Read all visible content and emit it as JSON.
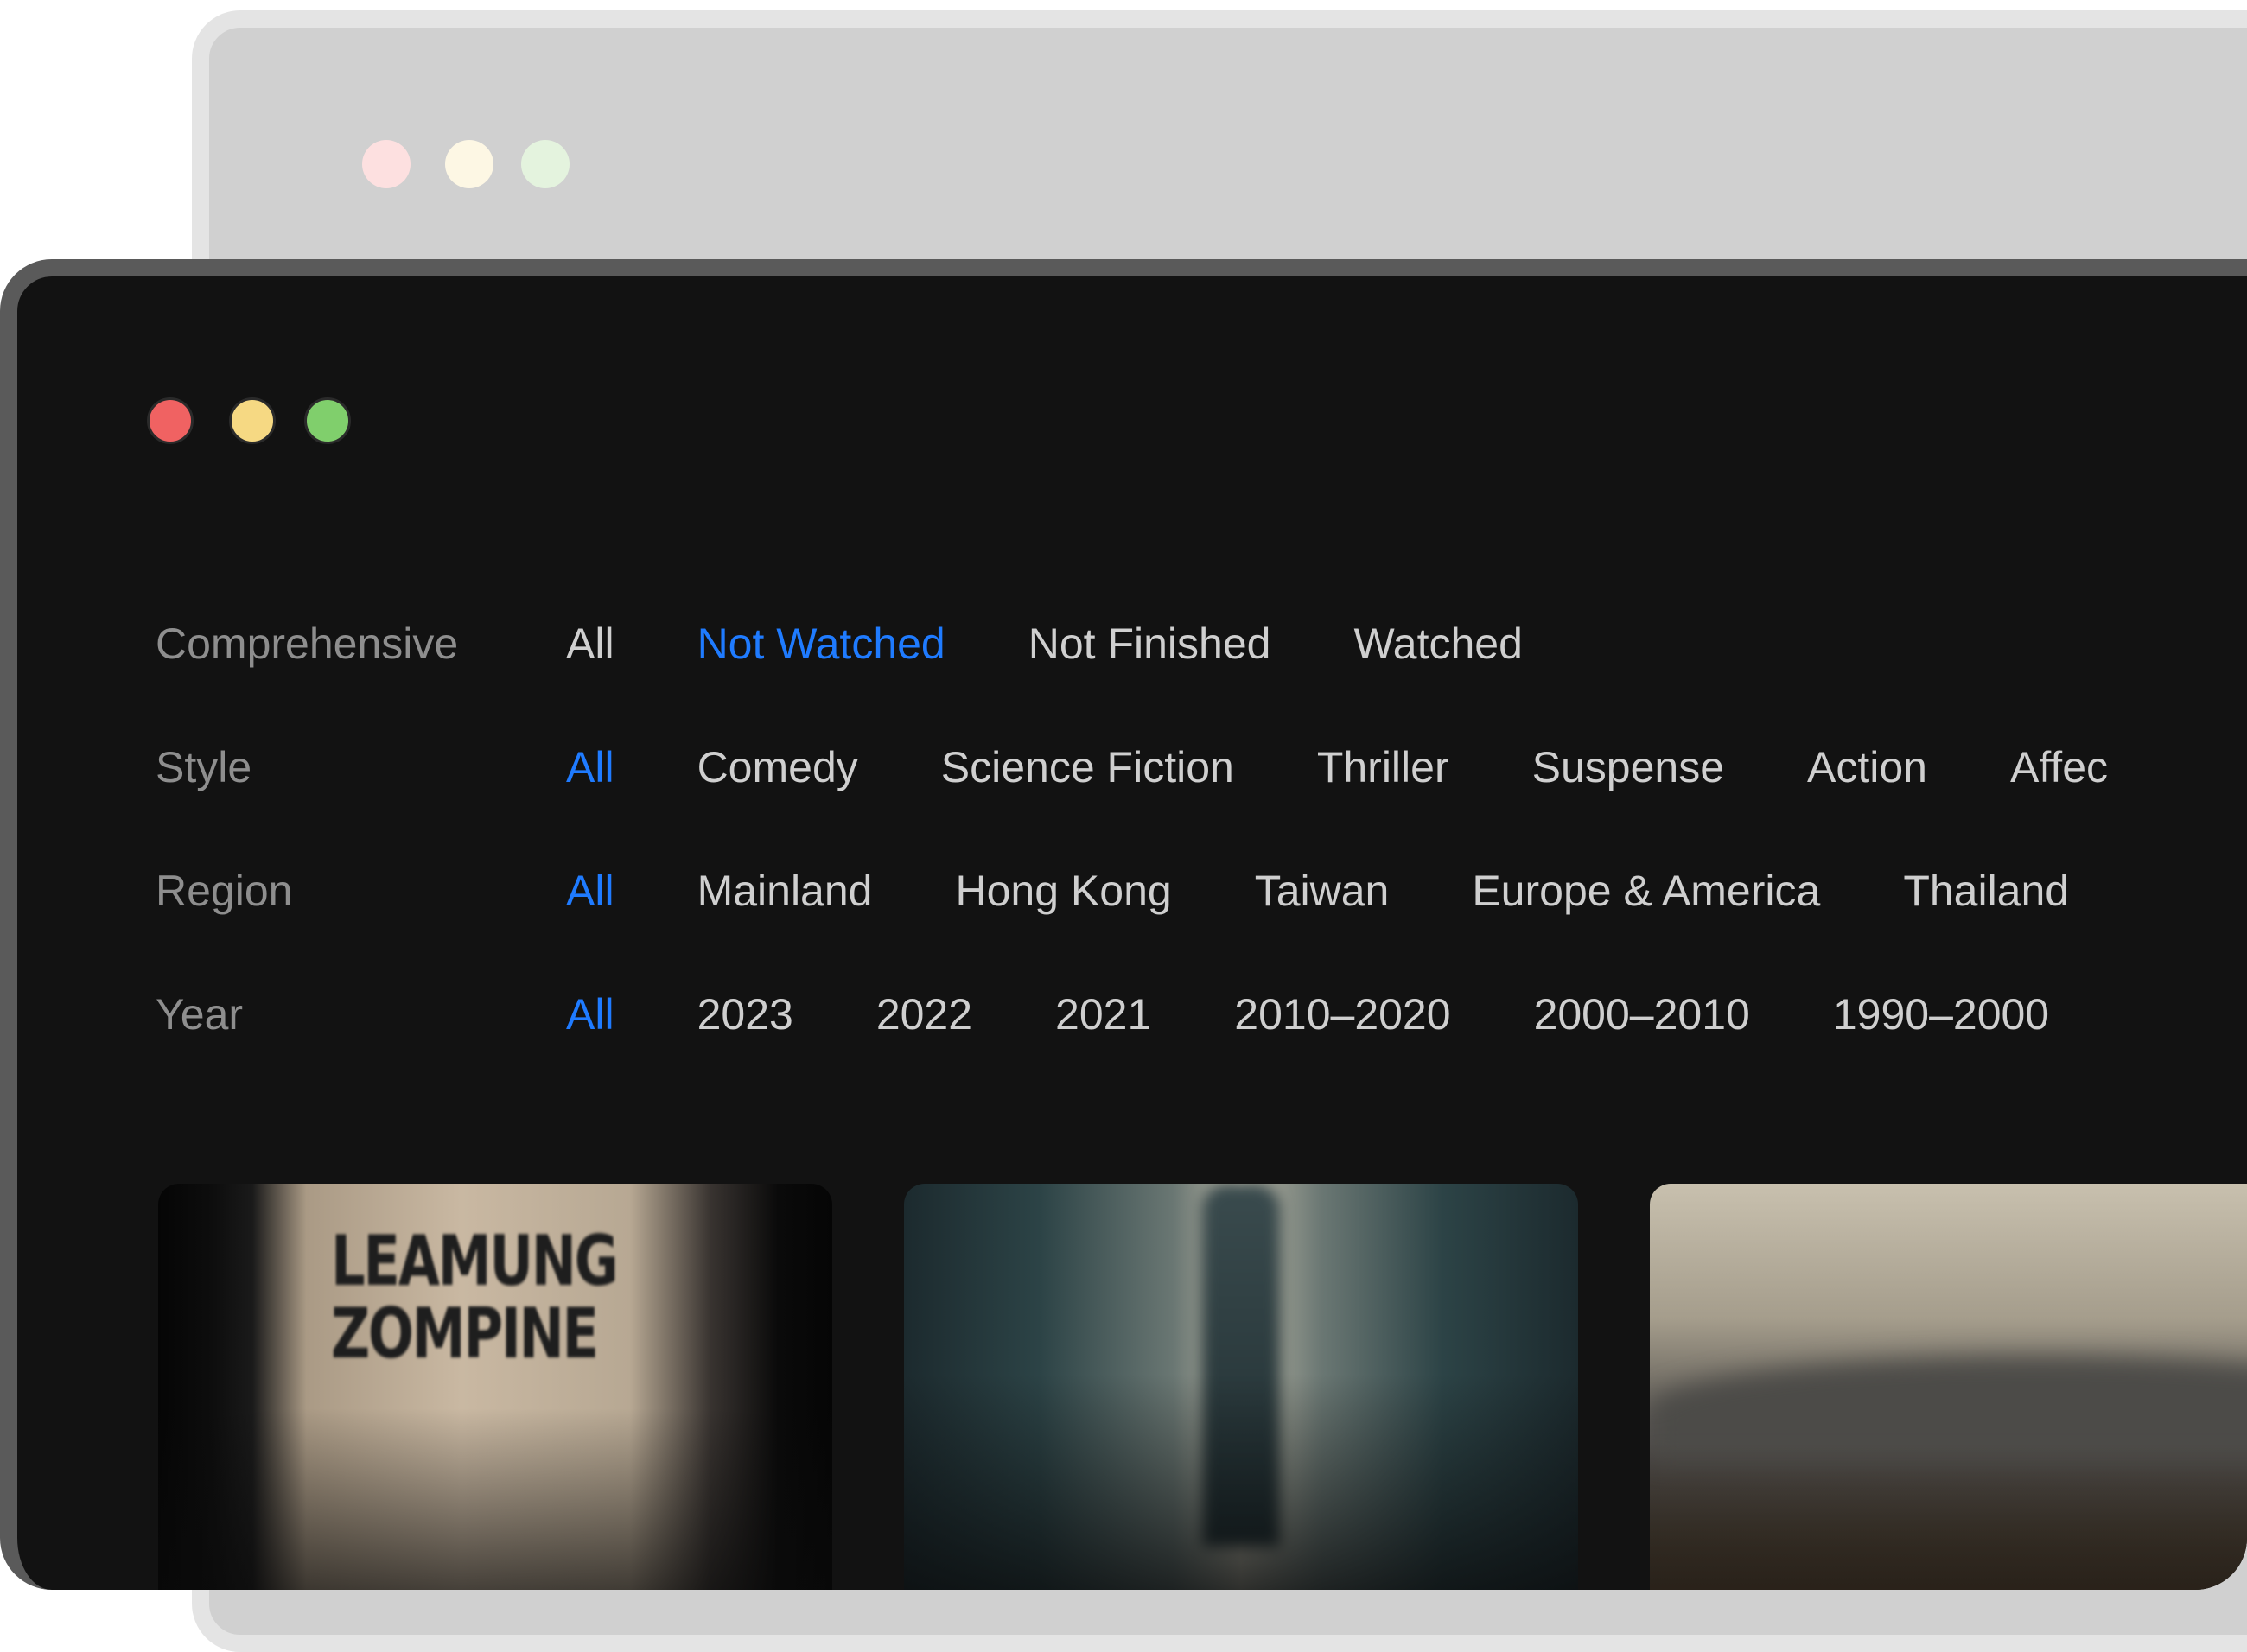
{
  "filters": {
    "comprehensive": {
      "label": "Comprehensive",
      "options": [
        "All",
        "Not Watched",
        "Not Finished",
        "Watched"
      ],
      "selected": "Not Watched"
    },
    "style": {
      "label": "Style",
      "options": [
        "All",
        "Comedy",
        "Science Fiction",
        "Thriller",
        "Suspense",
        "Action",
        "Affec"
      ],
      "selected": "All"
    },
    "region": {
      "label": "Region",
      "options": [
        "All",
        "Mainland",
        "Hong Kong",
        "Taiwan",
        "Europe & America",
        "Thailand"
      ],
      "selected": "All"
    },
    "year": {
      "label": "Year",
      "options": [
        "All",
        "2023",
        "2022",
        "2021",
        "2010–2020",
        "2000–2010",
        "1990–2000"
      ],
      "selected": "All"
    }
  },
  "posters": [
    {
      "title": "LEAMUNG ZOMPINE"
    },
    {
      "title": ""
    },
    {
      "title": ""
    }
  ],
  "colors": {
    "accent": "#1f7bff",
    "window_bg": "#121212",
    "traffic_red": "#f06262",
    "traffic_yellow": "#f6d983",
    "traffic_green": "#80cf6c"
  }
}
